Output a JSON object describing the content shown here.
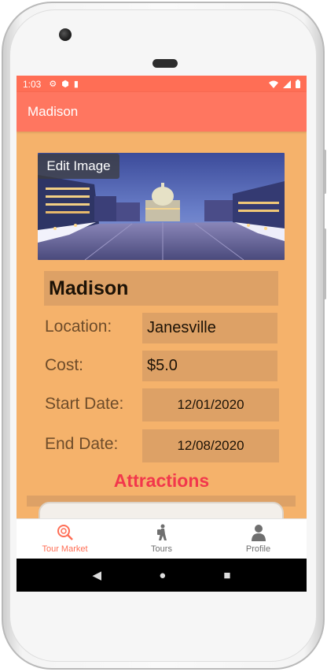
{
  "status_bar": {
    "time": "1:03",
    "icons": [
      "gear-icon",
      "shield-icon",
      "sd-card-icon",
      "wifi-icon",
      "signal-icon",
      "battery-icon"
    ]
  },
  "app_bar": {
    "title": "Madison"
  },
  "hero": {
    "edit_label": "Edit Image",
    "image_icon": "city-night-photo"
  },
  "tour": {
    "name": "Madison",
    "location_label": "Location:",
    "location_value": "Janesville",
    "cost_label": "Cost:",
    "cost_value": "$5.0",
    "start_label": "Start Date:",
    "start_value": "12/01/2020",
    "end_label": "End Date:",
    "end_value": "12/08/2020"
  },
  "attractions": {
    "heading": "Attractions"
  },
  "bottom_nav": {
    "items": [
      {
        "label": "Tour Market",
        "icon": "search-map-icon",
        "active": true
      },
      {
        "label": "Tours",
        "icon": "hiker-icon",
        "active": false
      },
      {
        "label": "Profile",
        "icon": "person-icon",
        "active": false
      }
    ]
  },
  "system_nav": {
    "back": "◀",
    "home": "●",
    "recents": "■"
  },
  "colors": {
    "accent": "#ff6e55",
    "background": "#f5b26b",
    "field": "#dda166",
    "attractions": "#f2374c"
  }
}
